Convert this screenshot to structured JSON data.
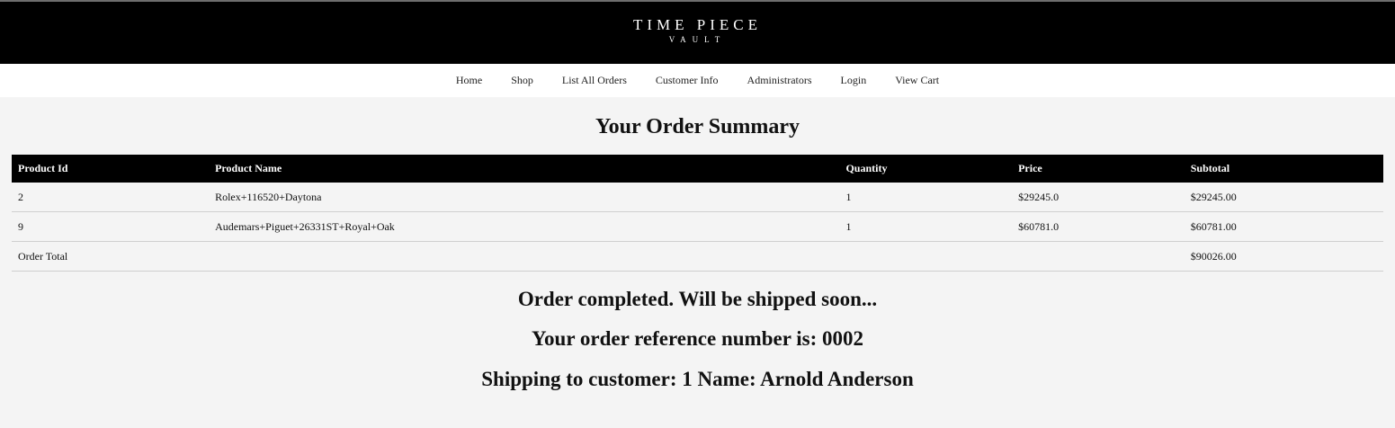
{
  "brand": {
    "line1": "TIME PIECE",
    "line2": "VAULT"
  },
  "nav": {
    "items": [
      {
        "label": "Home"
      },
      {
        "label": "Shop"
      },
      {
        "label": "List All Orders"
      },
      {
        "label": "Customer Info"
      },
      {
        "label": "Administrators"
      },
      {
        "label": "Login"
      },
      {
        "label": "View Cart"
      }
    ]
  },
  "page": {
    "title": "Your Order Summary"
  },
  "table": {
    "headers": [
      "Product Id",
      "Product Name",
      "Quantity",
      "Price",
      "Subtotal"
    ],
    "rows": [
      {
        "id": "2",
        "name": "Rolex+116520+Daytona",
        "quantity": "1",
        "price": "$29245.0",
        "subtotal": "$29245.00"
      },
      {
        "id": "9",
        "name": "Audemars+Piguet+26331ST+Royal+Oak",
        "quantity": "1",
        "price": "$60781.0",
        "subtotal": "$60781.00"
      }
    ],
    "total_label": "Order Total",
    "total_value": "$90026.00"
  },
  "messages": {
    "status": "Order completed. Will be shipped soon...",
    "reference": "Your order reference number is: 0002",
    "shipping": "Shipping to customer: 1 Name: Arnold Anderson"
  }
}
